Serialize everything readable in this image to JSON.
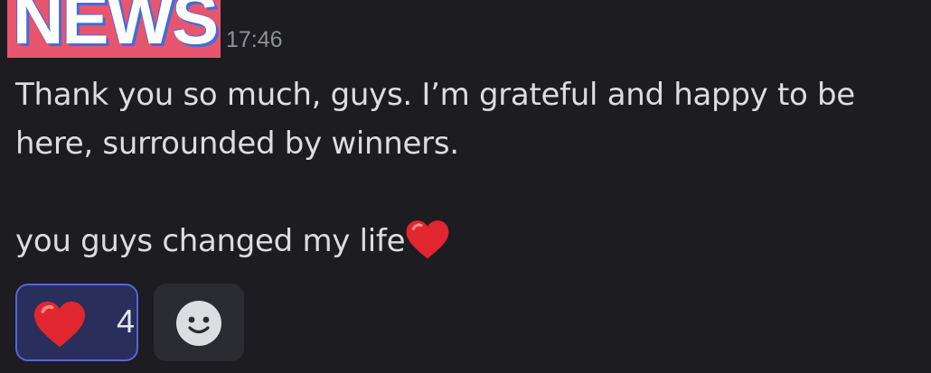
{
  "badge": {
    "text": "NEWS"
  },
  "message": {
    "timestamp": "17:46",
    "line1": "Thank you so much, guys. I’m grateful and happy to be",
    "line2": "here, surrounded by winners.",
    "line3": "you guys changed my life",
    "inline_emoji": "red-heart-emoji"
  },
  "reactions": [
    {
      "emoji": "red-heart-emoji",
      "count": "4",
      "selected": true
    }
  ],
  "colors": {
    "background": "#1c1c21",
    "badge_bg": "#e8556f",
    "reaction_selected_border": "#5865d8",
    "reaction_selected_bg": "#2a2e5a",
    "heart": "#e0262e"
  }
}
